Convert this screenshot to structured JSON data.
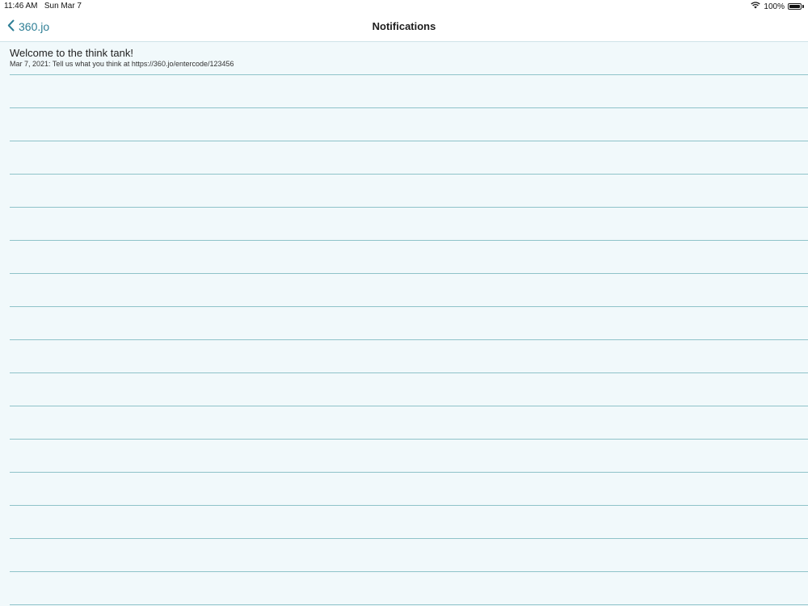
{
  "status_bar": {
    "time": "11:46 AM",
    "date": "Sun Mar 7",
    "battery": "100%",
    "battery_level": 1.0,
    "icons": [
      "wifi-icon",
      "battery-icon"
    ]
  },
  "nav": {
    "back_label": "360.jo",
    "title": "Notifications",
    "accent_color": "#2f7f96"
  },
  "notifications": [
    {
      "title": "Welcome to the think tank!",
      "subtitle": "Mar 7, 2021: Tell us what you think at https://360.jo/entercode/123456"
    }
  ],
  "empty_row_count": 16,
  "colors": {
    "background": "#f1f9fb",
    "separator": "#8fc3c9"
  }
}
